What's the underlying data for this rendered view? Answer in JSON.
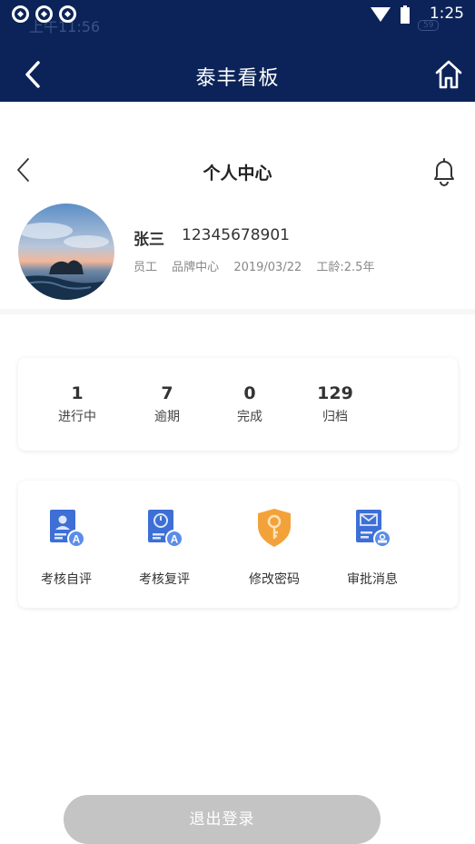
{
  "status_bar": {
    "ghost_time": "上午11:56",
    "time": "1:25",
    "battery_badge": "59"
  },
  "header": {
    "title": "泰丰看板",
    "back_icon": "chevron-left-icon",
    "home_icon": "home-icon"
  },
  "subheader": {
    "title": "个人中心",
    "back_icon": "chevron-left-icon",
    "bell_icon": "bell-icon"
  },
  "profile": {
    "name": "张三",
    "phone": "12345678901",
    "role": "员工",
    "department": "品牌中心",
    "date": "2019/03/22",
    "tenure": "工龄:2.5年"
  },
  "stats": [
    {
      "value": "1",
      "label": "进行中"
    },
    {
      "value": "7",
      "label": "逾期"
    },
    {
      "value": "0",
      "label": "完成"
    },
    {
      "value": "129",
      "label": "归档"
    }
  ],
  "menu": [
    {
      "label": "考核自评",
      "icon": "self-review-icon"
    },
    {
      "label": "考核复评",
      "icon": "re-review-icon"
    },
    {
      "label": "修改密码",
      "icon": "key-shield-icon"
    },
    {
      "label": "审批消息",
      "icon": "approval-mail-icon"
    }
  ],
  "pager": {
    "count": 4,
    "active": 1
  },
  "logout": {
    "label": "退出登录"
  },
  "colors": {
    "header_bg": "#0b2358",
    "button_bg": "#c4c4c4",
    "icon_blue": "#3d6fd6",
    "icon_orange": "#f3a23a"
  }
}
